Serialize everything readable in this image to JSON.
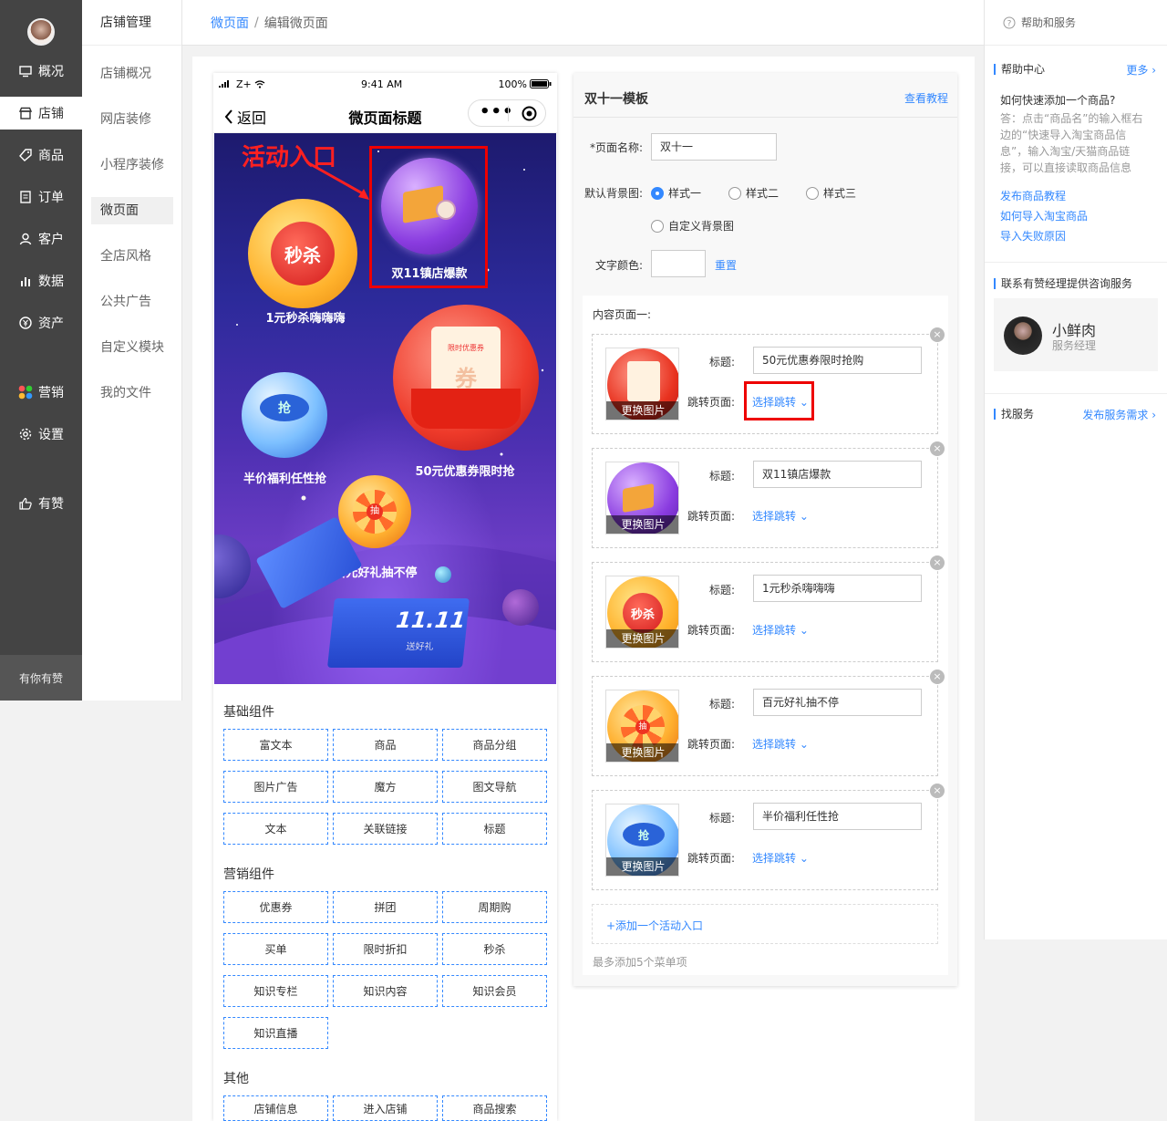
{
  "nav": {
    "items": [
      "概况",
      "店铺",
      "商品",
      "订单",
      "客户",
      "数据",
      "资产",
      "营销",
      "设置",
      "有赞"
    ],
    "footer": "有你有赞"
  },
  "subnav": {
    "title": "店铺管理",
    "items": [
      "店铺概况",
      "网店装修",
      "小程序装修",
      "微页面",
      "全店风格",
      "公共广告",
      "自定义模块",
      "我的文件"
    ]
  },
  "breadcrumb": {
    "link": "微页面",
    "sep": "/",
    "current": "编辑微页面"
  },
  "phone": {
    "signal": "Z+",
    "time": "9:41 AM",
    "battery": "100%",
    "back": "返回",
    "title": "微页面标题",
    "annotation": "活动入口",
    "balls": [
      "双11镇店爆款",
      "1元秒杀嗨嗨嗨",
      "50元优惠券限时抢",
      "半价福利任性抢",
      "百元好礼抽不停"
    ],
    "ball_texts": {
      "miaosha": "秒杀",
      "coupon_tag": "限时优惠券",
      "coupon": "券",
      "qiang": "抢",
      "chou": "抽"
    },
    "giftbox": {
      "big": "11.11",
      "small": "送好礼"
    }
  },
  "palette": {
    "basic_title": "基础组件",
    "basic": [
      "富文本",
      "商品",
      "商品分组",
      "图片广告",
      "魔方",
      "图文导航",
      "文本",
      "关联链接",
      "标题"
    ],
    "marketing_title": "营销组件",
    "marketing": [
      "优惠券",
      "拼团",
      "周期购",
      "买单",
      "限时折扣",
      "秒杀",
      "知识专栏",
      "知识内容",
      "知识会员",
      "知识直播"
    ],
    "other_title": "其他",
    "other": [
      "店铺信息",
      "进入店铺",
      "商品搜索"
    ]
  },
  "editor": {
    "title": "双十一模板",
    "tutorial": "查看教程",
    "page_name_label": "*页面名称:",
    "page_name_value": "双十一",
    "bg_label": "默认背景图:",
    "bg_options": [
      "样式一",
      "样式二",
      "样式三",
      "自定义背景图"
    ],
    "text_color_label": "文字颜色:",
    "reset": "重置",
    "content_label": "内容页面一:",
    "change_img": "更换图片",
    "title_label": "标题:",
    "jump_label": "跳转页面:",
    "jump_link": "选择跳转",
    "close": "×",
    "cards": [
      "50元优惠券限时抢购",
      "双11镇店爆款",
      "1元秒杀嗨嗨嗨",
      "百元好礼抽不停",
      "半价福利任性抢"
    ],
    "add_entry": "+添加一个活动入口",
    "hint": "最多添加5个菜单项"
  },
  "help": {
    "top": "帮助和服务",
    "center_title": "帮助中心",
    "more": "更多",
    "question": "如何快速添加一个商品?",
    "answer": "答：点击“商品名”的输入框右边的“快速导入淘宝商品信息”，输入淘宝/天猫商品链接，可以直接读取商品信息",
    "links": [
      "发布商品教程",
      "如何导入淘宝商品",
      "导入失败原因"
    ],
    "manager_title": "联系有赞经理提供咨询服务",
    "manager_name": "小鲜肉",
    "manager_role": "服务经理",
    "find_title": "找服务",
    "find_link": "发布服务需求"
  },
  "colors": {
    "accent": "#3388ff",
    "nav_bg": "#444444",
    "annotation": "#ee0000"
  }
}
